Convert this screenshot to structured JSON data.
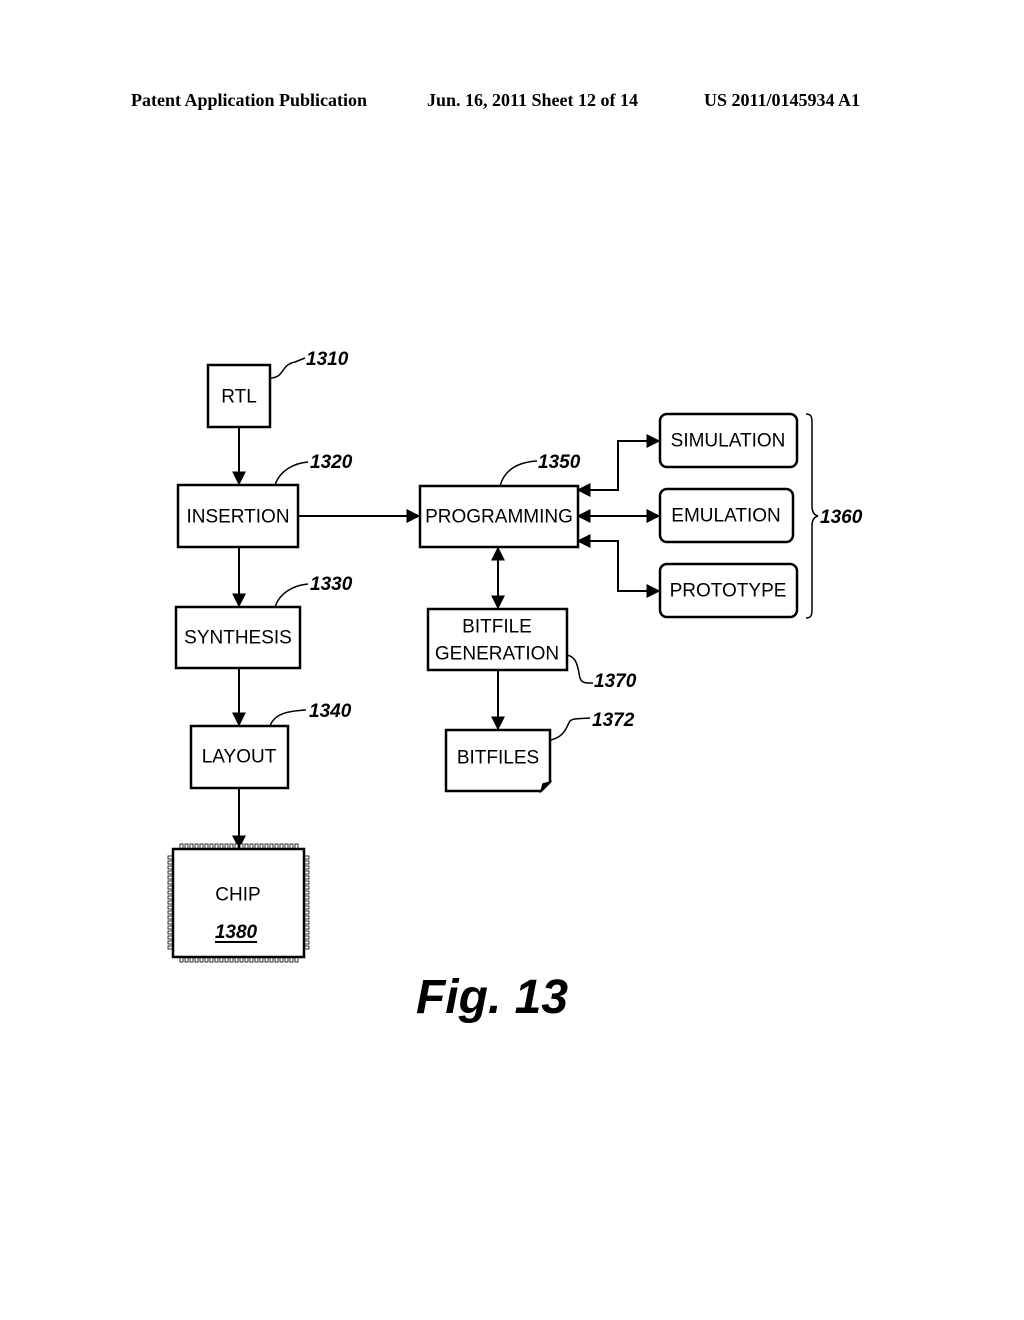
{
  "header": {
    "publication": "Patent Application Publication",
    "date_sheet": "Jun. 16, 2011  Sheet 12 of 14",
    "number": "US 2011/0145934 A1"
  },
  "nodes": {
    "rtl": {
      "label": "RTL",
      "ref": "1310"
    },
    "insertion": {
      "label": "INSERTION",
      "ref": "1320"
    },
    "synthesis": {
      "label": "SYNTHESIS",
      "ref": "1330"
    },
    "layout": {
      "label": "LAYOUT",
      "ref": "1340"
    },
    "programming": {
      "label": "PROGRAMMING",
      "ref": "1350"
    },
    "simulation": {
      "label": "SIMULATION"
    },
    "emulation": {
      "label": "EMULATION"
    },
    "prototype": {
      "label": "PROTOTYPE"
    },
    "group_ref": "1360",
    "bitfile_generation": {
      "label_line1": "BITFILE",
      "label_line2": "GENERATION",
      "ref": "1370"
    },
    "bitfiles": {
      "label": "BITFILES",
      "ref": "1372"
    },
    "chip": {
      "label": "CHIP",
      "ref": "1380"
    }
  },
  "edges": [
    {
      "from": "RTL",
      "to": "INSERTION",
      "direction": "forward"
    },
    {
      "from": "INSERTION",
      "to": "SYNTHESIS",
      "direction": "forward"
    },
    {
      "from": "SYNTHESIS",
      "to": "LAYOUT",
      "direction": "forward"
    },
    {
      "from": "LAYOUT",
      "to": "CHIP",
      "direction": "forward"
    },
    {
      "from": "INSERTION",
      "to": "PROGRAMMING",
      "direction": "forward"
    },
    {
      "from": "PROGRAMMING",
      "to": "SIMULATION",
      "direction": "bidirectional"
    },
    {
      "from": "PROGRAMMING",
      "to": "EMULATION",
      "direction": "bidirectional"
    },
    {
      "from": "PROGRAMMING",
      "to": "PROTOTYPE",
      "direction": "bidirectional"
    },
    {
      "from": "PROGRAMMING",
      "to": "BITFILE GENERATION",
      "direction": "bidirectional"
    },
    {
      "from": "BITFILE GENERATION",
      "to": "BITFILES",
      "direction": "forward"
    }
  ],
  "figure_caption": "Fig. 13"
}
